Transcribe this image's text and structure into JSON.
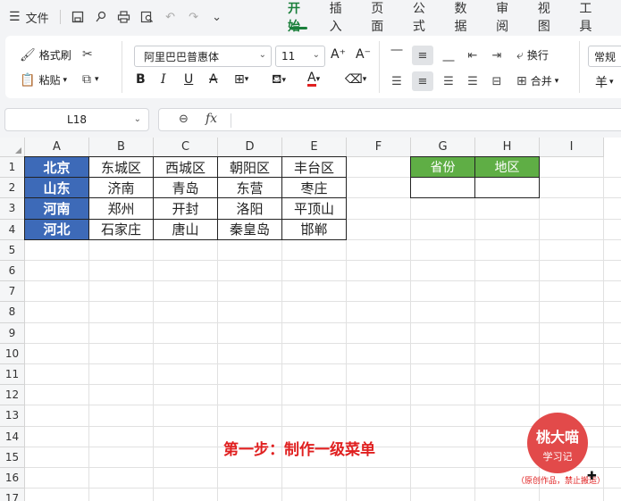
{
  "menu": {
    "file_label": "文件",
    "tabs": [
      "开始",
      "插入",
      "页面",
      "公式",
      "数据",
      "审阅",
      "视图",
      "工具"
    ],
    "active_tab": "开始"
  },
  "ribbon": {
    "format_painter": "格式刷",
    "paste": "粘贴",
    "font_name": "阿里巴巴普惠体",
    "font_size": "11",
    "wrap": "换行",
    "merge": "合并",
    "style": "常规",
    "currency": "羊"
  },
  "formula_bar": {
    "name_box": "L18",
    "fx": "fx",
    "formula": ""
  },
  "columns": [
    "A",
    "B",
    "C",
    "D",
    "E",
    "F",
    "G",
    "H",
    "I"
  ],
  "rows": [
    "1",
    "2",
    "3",
    "4",
    "5",
    "6",
    "7",
    "8",
    "9",
    "10",
    "11",
    "12",
    "13",
    "14",
    "15",
    "16",
    "17"
  ],
  "table": [
    [
      "北京",
      "东城区",
      "西城区",
      "朝阳区",
      "丰台区"
    ],
    [
      "山东",
      "济南",
      "青岛",
      "东营",
      "枣庄"
    ],
    [
      "河南",
      "郑州",
      "开封",
      "洛阳",
      "平顶山"
    ],
    [
      "河北",
      "石家庄",
      "唐山",
      "秦皇岛",
      "邯郸"
    ]
  ],
  "lookup": {
    "header_province": "省份",
    "header_region": "地区"
  },
  "overlay": {
    "caption": "第一步：制作一级菜单",
    "logo_line1": "桃大喵",
    "logo_line2": "学习记",
    "credit": "（原创作品，禁止搬运）"
  },
  "colors": {
    "accent": "#1a7f3b",
    "province_fill": "#3d6ab8",
    "lookup_fill": "#5fae45",
    "caption": "#e02020"
  }
}
